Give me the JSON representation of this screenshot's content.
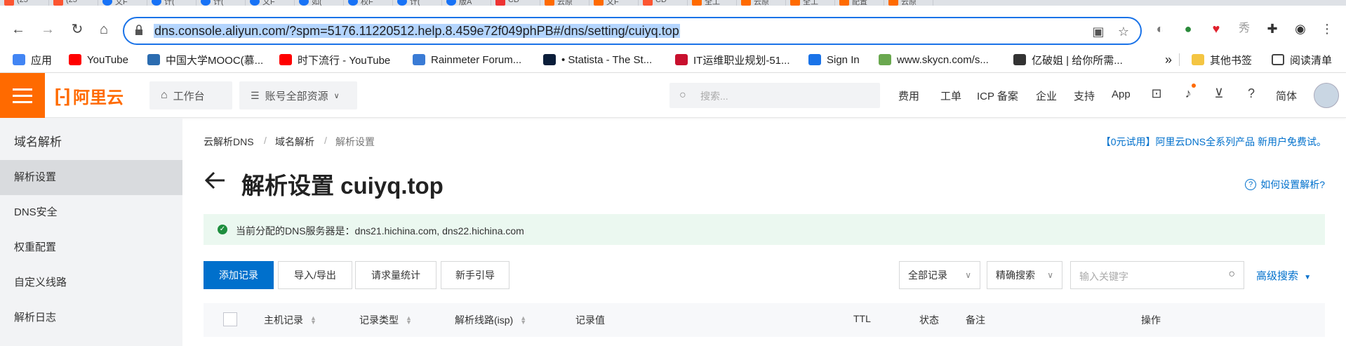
{
  "browser": {
    "tabs": [
      {
        "title": "(25",
        "icon": "csdn"
      },
      {
        "title": "(25",
        "icon": "csdn"
      },
      {
        "title": "文F",
        "icon": "zh"
      },
      {
        "title": "计(",
        "icon": "zh"
      },
      {
        "title": "计(",
        "icon": "zh"
      },
      {
        "title": "文F",
        "icon": "zh"
      },
      {
        "title": "如(",
        "icon": "zh"
      },
      {
        "title": "权F",
        "icon": "zh"
      },
      {
        "title": "计(",
        "icon": "zh"
      },
      {
        "title": "版A",
        "icon": "zh"
      },
      {
        "title": "CD",
        "icon": "red"
      },
      {
        "title": "云原",
        "icon": "ali"
      },
      {
        "title": "文F",
        "icon": "ali"
      },
      {
        "title": "CD",
        "icon": "csdn"
      },
      {
        "title": "全工",
        "icon": "ali"
      },
      {
        "title": "云原",
        "icon": "ali"
      },
      {
        "title": "全工",
        "icon": "ali"
      },
      {
        "title": "配置",
        "icon": "ali"
      },
      {
        "title": "云原",
        "icon": "ali"
      }
    ],
    "url": "dns.console.aliyun.com/?spm=5176.11220512.help.8.459e72f049phPB#/dns/setting/cuiyq.top",
    "bookmarks": [
      {
        "label": "应用",
        "color": "#4285f4"
      },
      {
        "label": "YouTube",
        "color": "#ff0000"
      },
      {
        "label": "中国大学MOOC(慕...",
        "color": "#2b6cb0"
      },
      {
        "label": "时下流行 - YouTube",
        "color": "#ff0000"
      },
      {
        "label": "Rainmeter Forum...",
        "color": "#3a7bd5"
      },
      {
        "label": "• Statista - The St...",
        "color": "#0b1e3a"
      },
      {
        "label": "IT运维职业规划-51...",
        "color": "#c8102e"
      },
      {
        "label": "Sign In",
        "color": "#1a73e8"
      },
      {
        "label": "www.skycn.com/s...",
        "color": "#6aa84f"
      },
      {
        "label": "亿破姐 | 给你所需...",
        "color": "#333333"
      }
    ],
    "bookmarks_overflow": "»",
    "other_bookmarks": "其他书签",
    "reading_list": "阅读清单"
  },
  "header": {
    "logo_text": "阿里云",
    "workbench": "工作台",
    "resources": "账号全部资源",
    "search_placeholder": "搜索...",
    "links": [
      "费用",
      "工单",
      "ICP 备案",
      "企业",
      "支持",
      "App"
    ],
    "language": "简体"
  },
  "sidebar": {
    "title": "域名解析",
    "items": [
      {
        "label": "解析设置",
        "active": true
      },
      {
        "label": "DNS安全",
        "active": false
      },
      {
        "label": "权重配置",
        "active": false
      },
      {
        "label": "自定义线路",
        "active": false
      },
      {
        "label": "解析日志",
        "active": false
      }
    ]
  },
  "main": {
    "breadcrumb": [
      "云解析DNS",
      "域名解析",
      "解析设置"
    ],
    "breadcrumb_sep": "/",
    "promo": "【0元试用】阿里云DNS全系列产品 新用户免费试。",
    "title": "解析设置 cuiyq.top",
    "help": "如何设置解析?",
    "alert": "当前分配的DNS服务器是：dns21.hichina.com, dns22.hichina.com",
    "buttons": {
      "add": "添加记录",
      "import_export": "导入/导出",
      "stats": "请求量统计",
      "guide": "新手引导"
    },
    "filter_all": "全部记录",
    "filter_exact": "精确搜索",
    "keyword_placeholder": "输入关键字",
    "advanced": "高级搜索",
    "columns": [
      "主机记录",
      "记录类型",
      "解析线路(isp)",
      "记录值",
      "TTL",
      "状态",
      "备注",
      "操作"
    ]
  },
  "colors": {
    "brand": "#ff6a00",
    "primary": "#0070cc",
    "success_bg": "#ebf8f0"
  }
}
